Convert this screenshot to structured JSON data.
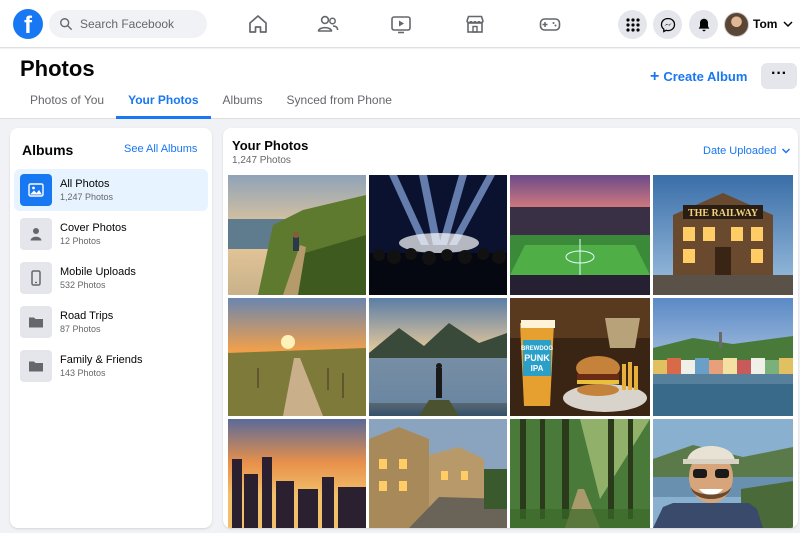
{
  "topbar": {
    "logo_letter": "f",
    "search_placeholder": "Search Facebook",
    "user_name": "Tom",
    "nav_icons": [
      "home-icon",
      "friends-icon",
      "watch-icon",
      "marketplace-icon",
      "gaming-icon"
    ],
    "action_icons": [
      "menu-grid-icon",
      "messenger-icon",
      "notifications-icon"
    ]
  },
  "header": {
    "title": "Photos",
    "tabs": [
      {
        "label": "Photos of You",
        "active": false
      },
      {
        "label": "Your Photos",
        "active": true
      },
      {
        "label": "Albums",
        "active": false
      },
      {
        "label": "Synced from Phone",
        "active": false
      }
    ],
    "create_album_plus": "+",
    "create_album_label": "Create Album",
    "more_label": "···"
  },
  "albums": {
    "title": "Albums",
    "see_all": "See All Albums",
    "items": [
      {
        "name": "All Photos",
        "count": "1,247 Photos",
        "icon": "photo-icon",
        "selected": true
      },
      {
        "name": "Cover Photos",
        "count": "12 Photos",
        "icon": "person-icon",
        "selected": false
      },
      {
        "name": "Mobile Uploads",
        "count": "532 Photos",
        "icon": "phone-icon",
        "selected": false
      },
      {
        "name": "Road Trips",
        "count": "87 Photos",
        "icon": "folder-icon",
        "selected": false
      },
      {
        "name": "Family & Friends",
        "count": "143 Photos",
        "icon": "folder-icon",
        "selected": false
      }
    ]
  },
  "photos": {
    "title": "Your Photos",
    "count": "1,247 Photos",
    "sort_label": "Date Uploaded",
    "items": [
      {
        "name": "photo-coastal-hike"
      },
      {
        "name": "photo-concert"
      },
      {
        "name": "photo-stadium"
      },
      {
        "name": "photo-pub",
        "sign_text": "THE RAILWAY"
      },
      {
        "name": "photo-sunset-path"
      },
      {
        "name": "photo-lake-reflection"
      },
      {
        "name": "photo-burger-beer",
        "glass_text": [
          "BREWDOG",
          "PUNK",
          "IPA"
        ]
      },
      {
        "name": "photo-harbor-town"
      },
      {
        "name": "photo-city-sunset"
      },
      {
        "name": "photo-village-street"
      },
      {
        "name": "photo-forest"
      },
      {
        "name": "photo-selfie"
      }
    ]
  },
  "colors": {
    "brand": "#1877f2",
    "selected_bg": "#e7f3ff",
    "page_bg": "#f0f2f5"
  }
}
